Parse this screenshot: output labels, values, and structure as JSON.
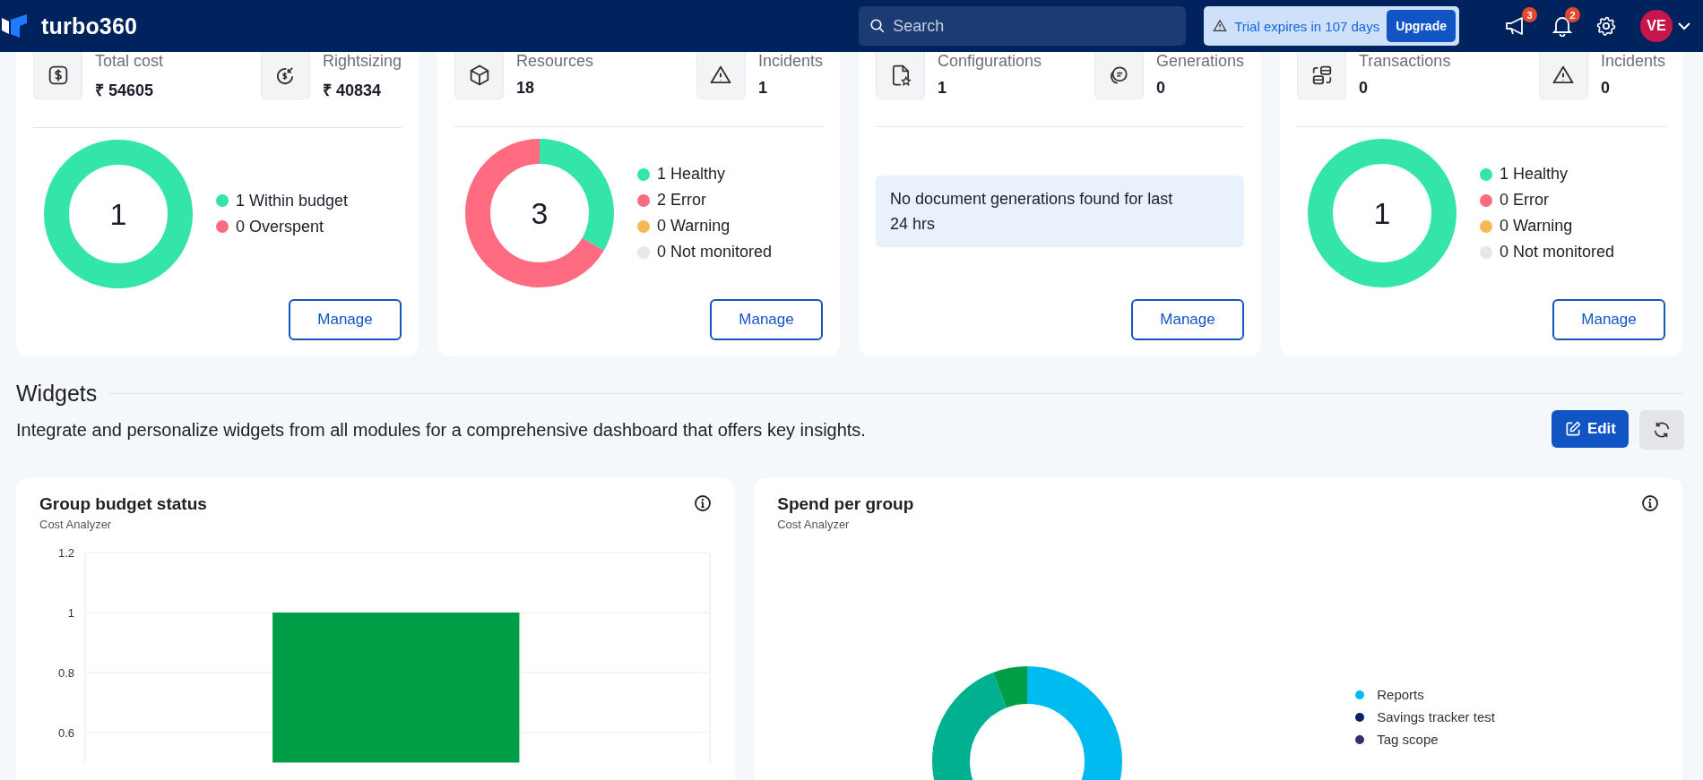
{
  "header": {
    "brand": "turbo360",
    "search": {
      "placeholder": "Search"
    },
    "trial": {
      "message": "Trial expires in 107 days",
      "button": "Upgrade"
    },
    "announcements_badge": "3",
    "notifications_badge": "2",
    "avatar": "VE"
  },
  "summaries": [
    {
      "stats": [
        {
          "label": "Total cost",
          "value": "₹ 54605"
        },
        {
          "label": "Rightsizing",
          "value": "₹ 40834"
        }
      ],
      "body": {
        "kind": "donut",
        "total": "1",
        "legend": [
          {
            "count": "1",
            "label": "Within budget",
            "color": "#34e5a8"
          },
          {
            "count": "0",
            "label": "Overspent",
            "color": "#ff6b80"
          }
        ]
      },
      "button": "Manage"
    },
    {
      "stats": [
        {
          "label": "Resources",
          "value": "18"
        },
        {
          "label": "Incidents",
          "value": "1"
        }
      ],
      "body": {
        "kind": "donut",
        "total": "3",
        "legend": [
          {
            "count": "1",
            "label": "Healthy",
            "color": "#34e5a8"
          },
          {
            "count": "2",
            "label": "Error",
            "color": "#ff6b80"
          },
          {
            "count": "0",
            "label": "Warning",
            "color": "#f7b955"
          },
          {
            "count": "0",
            "label": "Not monitored",
            "color": "#e5e7ec"
          }
        ]
      },
      "button": "Manage"
    },
    {
      "stats": [
        {
          "label": "Configurations",
          "value": "1"
        },
        {
          "label": "Generations",
          "value": "0"
        }
      ],
      "body": {
        "kind": "message",
        "text": "No document generations found for last 24 hrs"
      },
      "button": "Manage"
    },
    {
      "stats": [
        {
          "label": "Transactions",
          "value": "0"
        },
        {
          "label": "Incidents",
          "value": "0"
        }
      ],
      "body": {
        "kind": "donut",
        "total": "1",
        "legend": [
          {
            "count": "1",
            "label": "Healthy",
            "color": "#34e5a8"
          },
          {
            "count": "0",
            "label": "Error",
            "color": "#ff6b80"
          },
          {
            "count": "0",
            "label": "Warning",
            "color": "#f7b955"
          },
          {
            "count": "0",
            "label": "Not monitored",
            "color": "#e5e7ec"
          }
        ]
      },
      "button": "Manage"
    }
  ],
  "widgets_section": {
    "title": "Widgets",
    "description": "Integrate and personalize widgets from all modules for a comprehensive dashboard that offers key insights.",
    "edit_button": "Edit"
  },
  "widgets": [
    {
      "kind": "bar",
      "title": "Group budget status",
      "subtitle": "Cost Analyzer",
      "chart_data": {
        "type": "bar",
        "values": [
          1
        ],
        "ylim": [
          0.5,
          1.2
        ],
        "grid": true,
        "yticks": [
          0.6,
          0.8,
          1,
          1.2
        ]
      }
    },
    {
      "kind": "donut",
      "title": "Spend per group",
      "subtitle": "Cost Analyzer",
      "legend": [
        {
          "label": "Reports",
          "color": "#00bbf0"
        },
        {
          "label": "Savings tracker test",
          "color": "#0c1f6b"
        },
        {
          "label": "Tag scope",
          "color": "#3a2c6b"
        }
      ]
    }
  ]
}
